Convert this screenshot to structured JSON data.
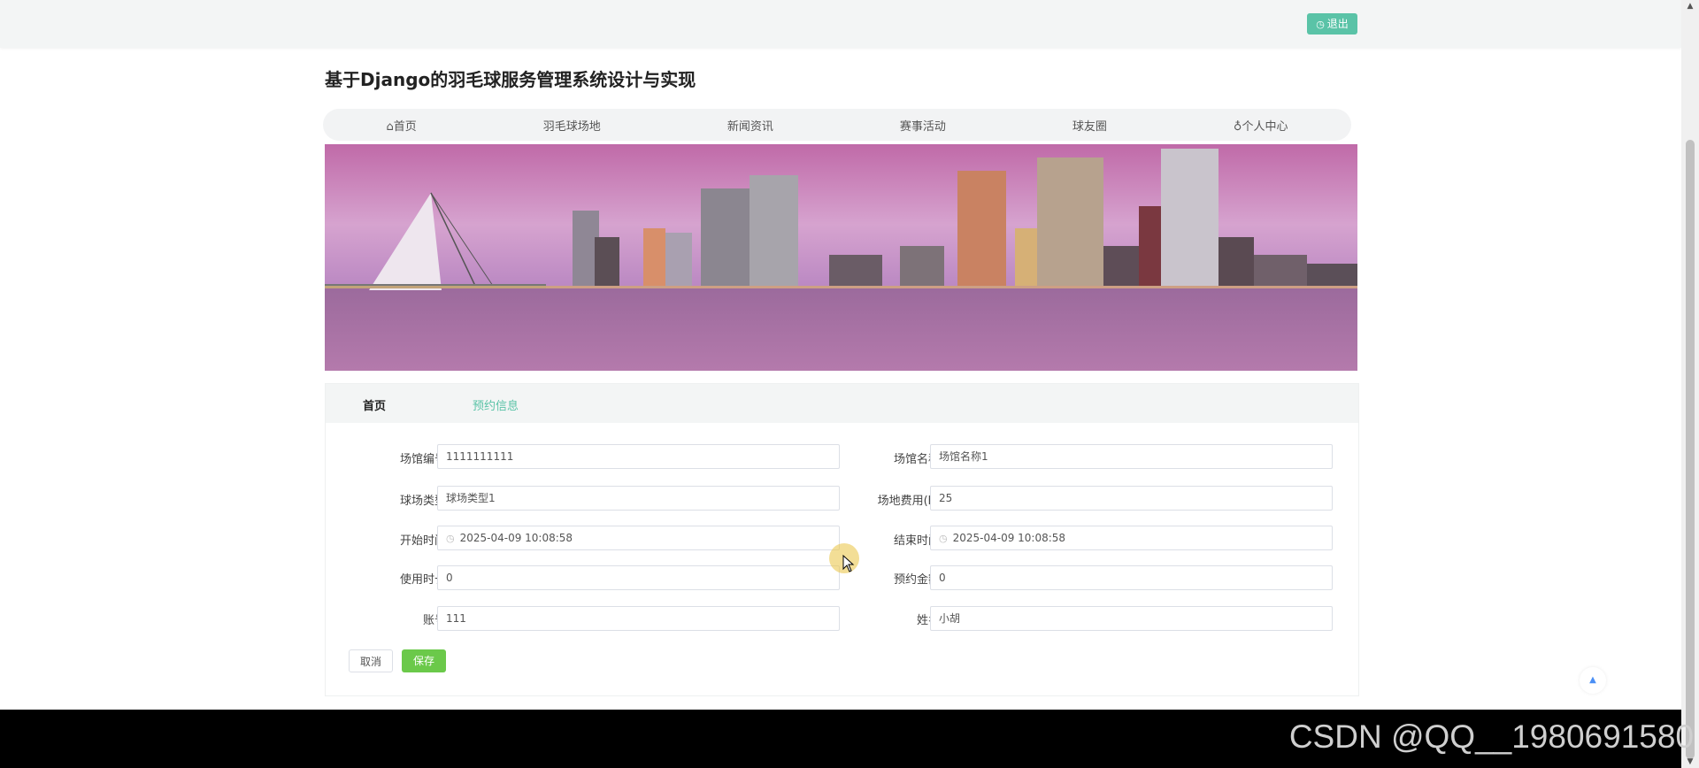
{
  "header": {
    "logout_label": "退出",
    "logout_icon": "clock-icon"
  },
  "site": {
    "title": "基于Django的羽毛球服务管理系统设计与实现"
  },
  "nav": {
    "items": [
      {
        "label": "首页",
        "icon": "home-icon"
      },
      {
        "label": "羽毛球场地"
      },
      {
        "label": "新闻资讯"
      },
      {
        "label": "赛事活动"
      },
      {
        "label": "球友圈"
      },
      {
        "label": "个人中心",
        "icon": "user-icon"
      }
    ]
  },
  "breadcrumb": {
    "home": "首页",
    "current": "预约信息"
  },
  "form": {
    "fields": [
      {
        "label": "场馆编号",
        "value": "1111111111"
      },
      {
        "label": "场馆名称",
        "value": "场馆名称1"
      },
      {
        "label": "球场类型",
        "value": "球场类型1"
      },
      {
        "label": "场地费用(h)",
        "value": "25"
      },
      {
        "label": "开始时间",
        "value": "2025-04-09 10:08:58",
        "icon": "clock-icon"
      },
      {
        "label": "结束时间",
        "value": "2025-04-09 10:08:58",
        "icon": "clock-icon"
      },
      {
        "label": "使用时长",
        "value": "0"
      },
      {
        "label": "预约金额",
        "value": "0"
      },
      {
        "label": "账号",
        "value": "111"
      },
      {
        "label": "姓名",
        "value": "小胡"
      }
    ],
    "cancel_label": "取消",
    "save_label": "保存"
  },
  "watermark": "CSDN @QQ__1980691580",
  "colors": {
    "accent": "#5ac3a7",
    "save": "#6bc94a",
    "banner_sky": "#c98ab8"
  }
}
